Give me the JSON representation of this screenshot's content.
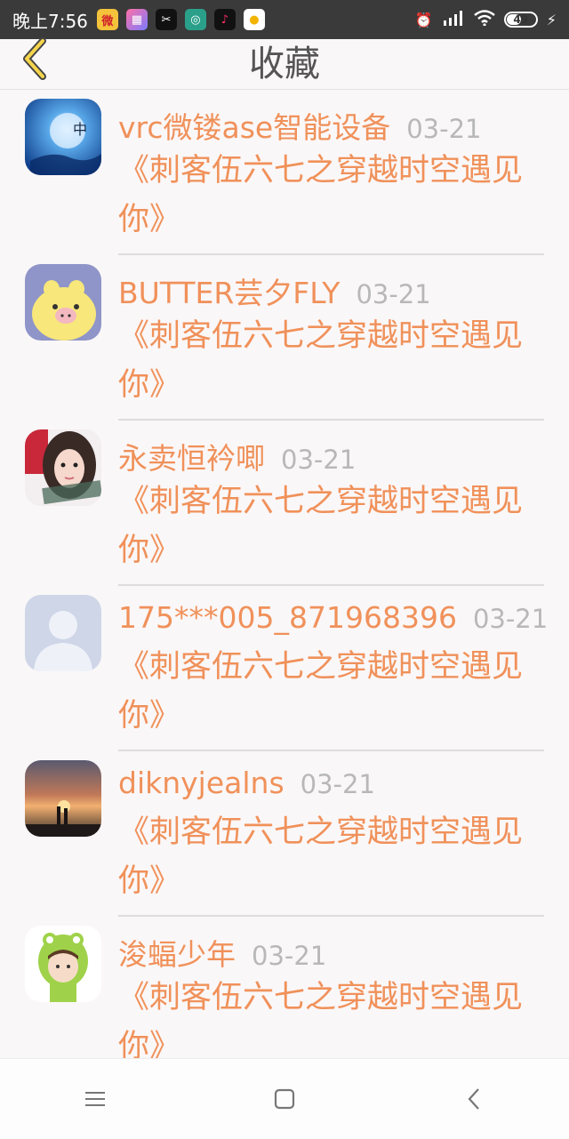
{
  "status_bar": {
    "time": "晚上7:56",
    "battery": "49",
    "apps": [
      "weibo-icon",
      "game-icon",
      "capcut-icon",
      "app-icon",
      "tiktok-icon",
      "chat-icon"
    ]
  },
  "header": {
    "title": "收藏"
  },
  "favorites": [
    {
      "username": "vrc微镂ase智能设备",
      "date": "03-21",
      "content": "《刺客伍六七之穿越时空遇见你》",
      "avatar": "blue-moon-avatar"
    },
    {
      "username": "BUTTER芸夕FLY",
      "date": "03-21",
      "content": "《刺客伍六七之穿越时空遇见你》",
      "avatar": "yellow-chick-avatar"
    },
    {
      "username": "永卖恒衿唧",
      "date": "03-21",
      "content": "《刺客伍六七之穿越时空遇见你》",
      "avatar": "girl-portrait-avatar"
    },
    {
      "username": "175***005_871968396",
      "date": "03-21",
      "content": "《刺客伍六七之穿越时空遇见你》",
      "avatar": "default-user-avatar"
    },
    {
      "username": "diknyjealns",
      "date": "03-21",
      "content": "《刺客伍六七之穿越时空遇见你》",
      "avatar": "sunset-couple-avatar"
    },
    {
      "username": "浚蝠少年",
      "date": "03-21",
      "content": "《刺客伍六七之穿越时空遇见你》",
      "avatar": "frog-hood-boy-avatar"
    }
  ],
  "nav_bar": {
    "items": [
      "menu-icon",
      "home-icon",
      "back-icon"
    ]
  }
}
